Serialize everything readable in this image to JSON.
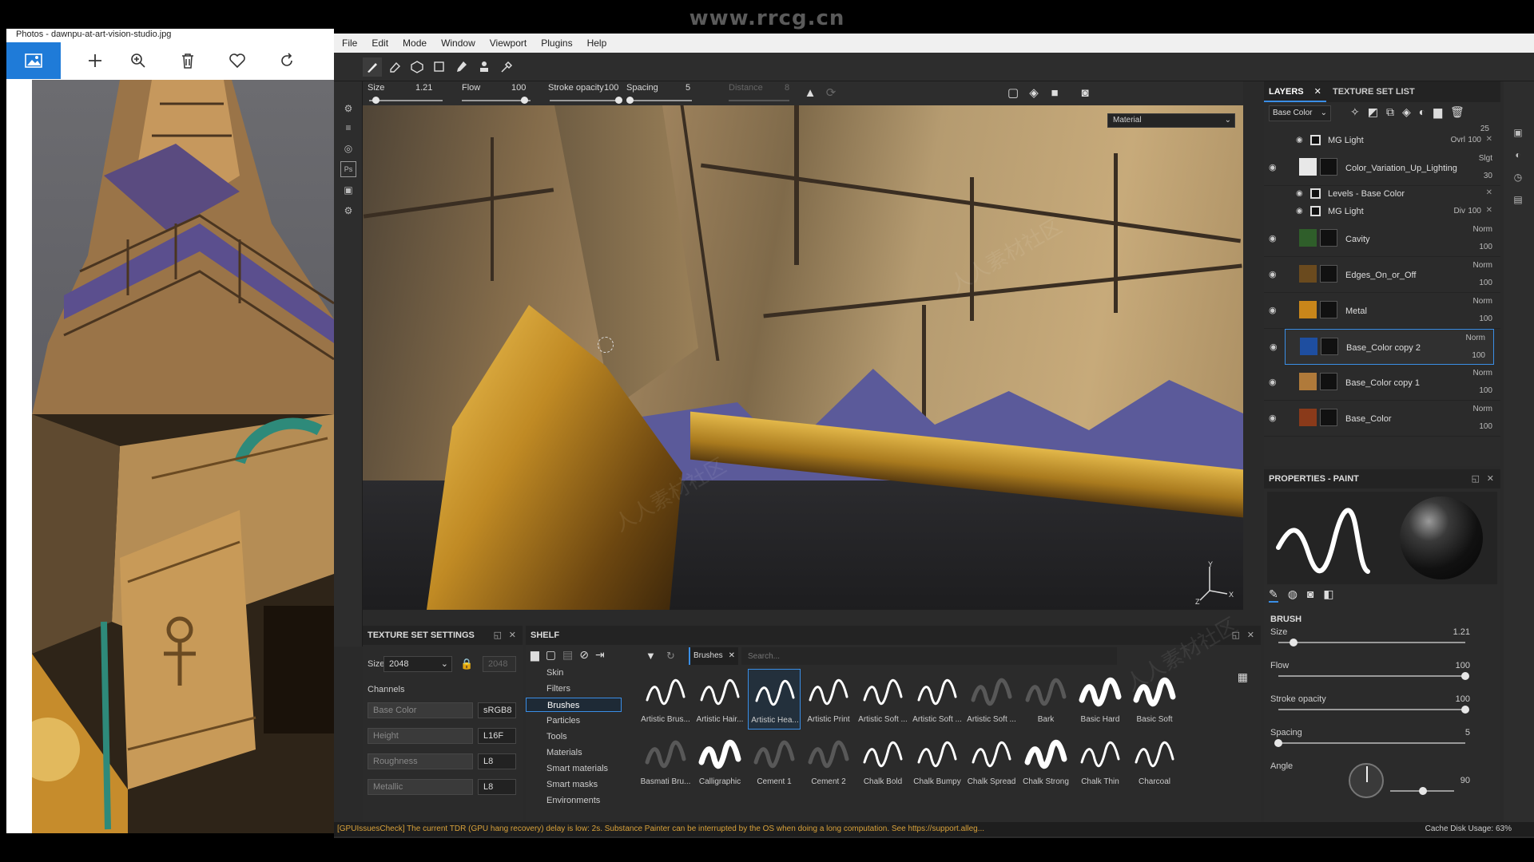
{
  "watermark": "www.rrcg.cn",
  "photos": {
    "title": "Photos - dawnpu-at-art-vision-studio.jpg",
    "toolbar": [
      {
        "name": "photo-icon"
      },
      {
        "name": "add-icon"
      },
      {
        "name": "zoom-icon"
      },
      {
        "name": "delete-icon"
      },
      {
        "name": "favorite-icon"
      },
      {
        "name": "rotate-icon"
      }
    ]
  },
  "menu": [
    "File",
    "Edit",
    "Mode",
    "Window",
    "Viewport",
    "Plugins",
    "Help"
  ],
  "brush_params": {
    "size_label": "Size",
    "size_value": "1.21",
    "flow_label": "Flow",
    "flow_value": "100",
    "opacity_label": "Stroke opacity",
    "opacity_value": "100",
    "spacing_label": "Spacing",
    "spacing_value": "5",
    "distance_label": "Distance",
    "distance_value": "8"
  },
  "viewport": {
    "material_mode": "Material"
  },
  "texture_set_settings": {
    "title": "TEXTURE SET SETTINGS",
    "size_label": "Size",
    "size_value": "2048",
    "size_locked": "2048",
    "channels_label": "Channels",
    "channels": [
      {
        "name": "Base Color",
        "format": "sRGB8"
      },
      {
        "name": "Height",
        "format": "L16F"
      },
      {
        "name": "Roughness",
        "format": "L8"
      },
      {
        "name": "Metallic",
        "format": "L8"
      }
    ]
  },
  "shelf": {
    "title": "SHELF",
    "filter_tag": "Brushes",
    "search_placeholder": "Search...",
    "categories": [
      "Skin",
      "Filters",
      "Brushes",
      "Particles",
      "Tools",
      "Materials",
      "Smart materials",
      "Smart masks",
      "Environments"
    ],
    "active_category": "Brushes",
    "brushes": [
      "Artistic Brus...",
      "Artistic Hair...",
      "Artistic Hea...",
      "Artistic Print",
      "Artistic Soft ...",
      "Artistic Soft ...",
      "Artistic Soft ...",
      "Bark",
      "Basic Hard",
      "Basic Soft",
      "Basmati Bru...",
      "Calligraphic",
      "Cement 1",
      "Cement 2",
      "Chalk Bold",
      "Chalk Bumpy",
      "Chalk Spread",
      "Chalk Strong",
      "Chalk Thin",
      "Charcoal"
    ]
  },
  "layers": {
    "tab_layers": "LAYERS",
    "tab_texture_set_list": "TEXTURE SET LIST",
    "channel_select": "Base Color",
    "top_opacity": "25",
    "rows": [
      {
        "kind": "sub",
        "name": "MG Light",
        "blend": "Ovrl",
        "opacity": "100"
      },
      {
        "kind": "layer",
        "name": "Color_Variation_Up_Lighting",
        "blend": "Slgt",
        "opacity": "30",
        "color": "#e8e8e8"
      },
      {
        "kind": "sub",
        "name": "Levels - Base Color",
        "blend": "",
        "opacity": ""
      },
      {
        "kind": "sub",
        "name": "MG Light",
        "blend": "Div",
        "opacity": "100"
      },
      {
        "kind": "layer",
        "name": "Cavity",
        "blend": "Norm",
        "opacity": "100",
        "color": "#2f5e2a"
      },
      {
        "kind": "layer",
        "name": "Edges_On_or_Off",
        "blend": "Norm",
        "opacity": "100",
        "color": "#6a4a1e"
      },
      {
        "kind": "layer",
        "name": "Metal",
        "blend": "Norm",
        "opacity": "100",
        "color": "#c9861a"
      },
      {
        "kind": "layer",
        "name": "Base_Color copy 2",
        "blend": "Norm",
        "opacity": "100",
        "color": "#1e4ea0",
        "selected": true
      },
      {
        "kind": "layer",
        "name": "Base_Color copy 1",
        "blend": "Norm",
        "opacity": "100",
        "color": "#b07a3a"
      },
      {
        "kind": "layer",
        "name": "Base_Color",
        "blend": "Norm",
        "opacity": "100",
        "color": "#8a3a1a"
      }
    ]
  },
  "properties": {
    "title": "PROPERTIES - PAINT",
    "section": "BRUSH",
    "size_label": "Size",
    "size_value": "1.21",
    "size_level": 0.08,
    "flow_label": "Flow",
    "flow_value": "100",
    "flow_level": 1.0,
    "opacity_label": "Stroke opacity",
    "opacity_value": "100",
    "opacity_level": 1.0,
    "spacing_label": "Spacing",
    "spacing_value": "5",
    "spacing_level": 0.0,
    "angle_label": "Angle",
    "angle_value": "90"
  },
  "status": {
    "message": "[GPUIssuesCheck] The current TDR (GPU hang recovery) delay is low: 2s. Substance Painter can be interrupted by the OS when doing a long computation. See https://support.alleg...",
    "cache": "Cache Disk Usage:   63%"
  }
}
